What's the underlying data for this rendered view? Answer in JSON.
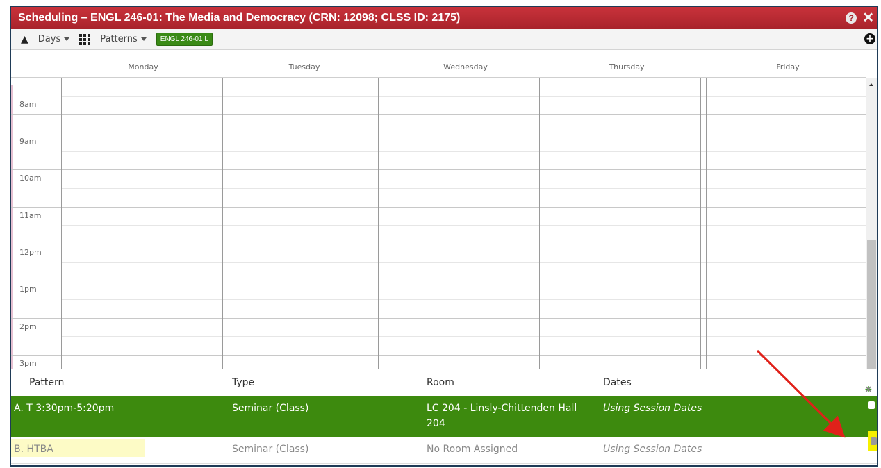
{
  "window": {
    "title": "Scheduling – ENGL 246-01: The Media and Democracy (CRN: 12098; CLSS ID: 2175)",
    "help_glyph": "?",
    "close_glyph": "✕"
  },
  "toolbar": {
    "days_label": "Days",
    "patterns_label": "Patterns",
    "course_badge": "ENGL 246-01 L",
    "add_glyph": "+"
  },
  "calendar": {
    "days": [
      "Monday",
      "Tuesday",
      "Wednesday",
      "Thursday",
      "Friday"
    ],
    "times": [
      "8am",
      "9am",
      "10am",
      "11am",
      "12pm",
      "1pm",
      "2pm",
      "3pm"
    ]
  },
  "table": {
    "headers": {
      "pattern": "Pattern",
      "type": "Type",
      "room": "Room",
      "dates": "Dates"
    },
    "add_glyph": "+",
    "remove_glyph": "×",
    "rows": [
      {
        "pattern": "A. T 3:30pm-5:20pm",
        "type": "Seminar (Class)",
        "room_line1": "LC 204 - Linsly-Chittenden Hall",
        "room_line2": "204",
        "dates": "Using Session Dates",
        "selected": true
      },
      {
        "pattern": "B. HTBA",
        "type": "Seminar (Class)",
        "room_line1": "No Room Assigned",
        "room_line2": "",
        "dates": "Using Session Dates",
        "selected": false
      }
    ]
  },
  "icons": {
    "fire": "fire-icon",
    "grid": "grid-icon",
    "layers": "layers-icon",
    "pencil": "pencil-icon",
    "trash": "trash-icon"
  },
  "colors": {
    "title_bar": "#b4262f",
    "selected_row": "#3d8a0e",
    "badge": "#3a8a16",
    "highlight_yellow": "#f6f000",
    "annotation_arrow": "#e0211a"
  }
}
